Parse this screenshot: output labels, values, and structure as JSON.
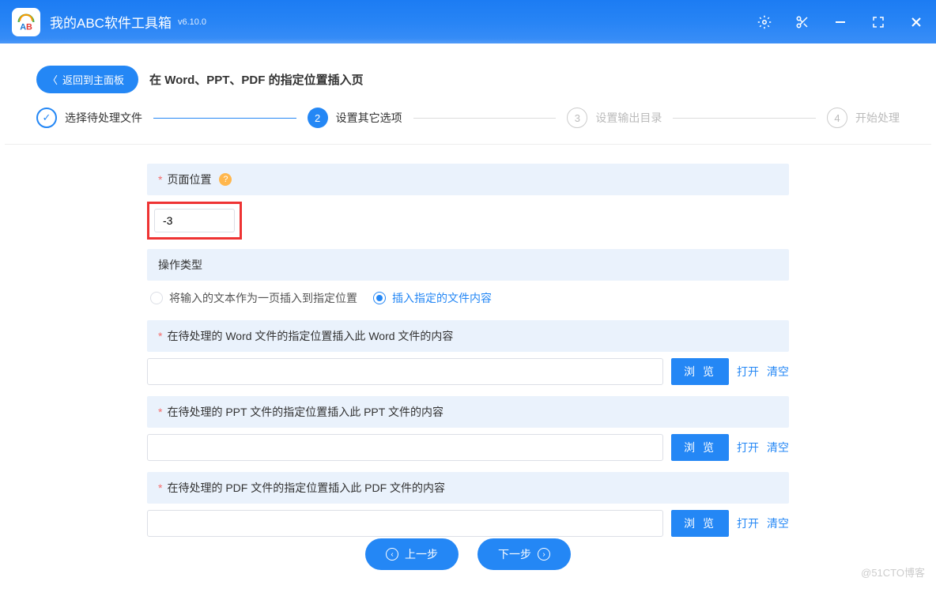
{
  "app": {
    "title": "我的ABC软件工具箱",
    "version": "v6.10.0"
  },
  "header": {
    "back_label": "返回到主面板",
    "page_title": "在 Word、PPT、PDF 的指定位置插入页"
  },
  "steps": [
    {
      "label": "选择待处理文件",
      "state": "done",
      "num": "✓"
    },
    {
      "label": "设置其它选项",
      "state": "active",
      "num": "2"
    },
    {
      "label": "设置输出目录",
      "state": "pending",
      "num": "3"
    },
    {
      "label": "开始处理",
      "state": "pending",
      "num": "4"
    }
  ],
  "page_position": {
    "label": "页面位置",
    "value": "-3"
  },
  "op_type": {
    "label": "操作类型",
    "options": [
      {
        "text": "将输入的文本作为一页插入到指定位置",
        "selected": false
      },
      {
        "text": "插入指定的文件内容",
        "selected": true
      }
    ]
  },
  "file_sections": [
    {
      "label": "在待处理的 Word 文件的指定位置插入此 Word 文件的内容"
    },
    {
      "label": "在待处理的 PPT 文件的指定位置插入此 PPT 文件的内容"
    },
    {
      "label": "在待处理的 PDF 文件的指定位置插入此 PDF 文件的内容"
    }
  ],
  "actions": {
    "browse": "浏 览",
    "open": "打开",
    "clear": "清空"
  },
  "nav": {
    "prev": "上一步",
    "next": "下一步"
  },
  "watermark": "@51CTO博客"
}
